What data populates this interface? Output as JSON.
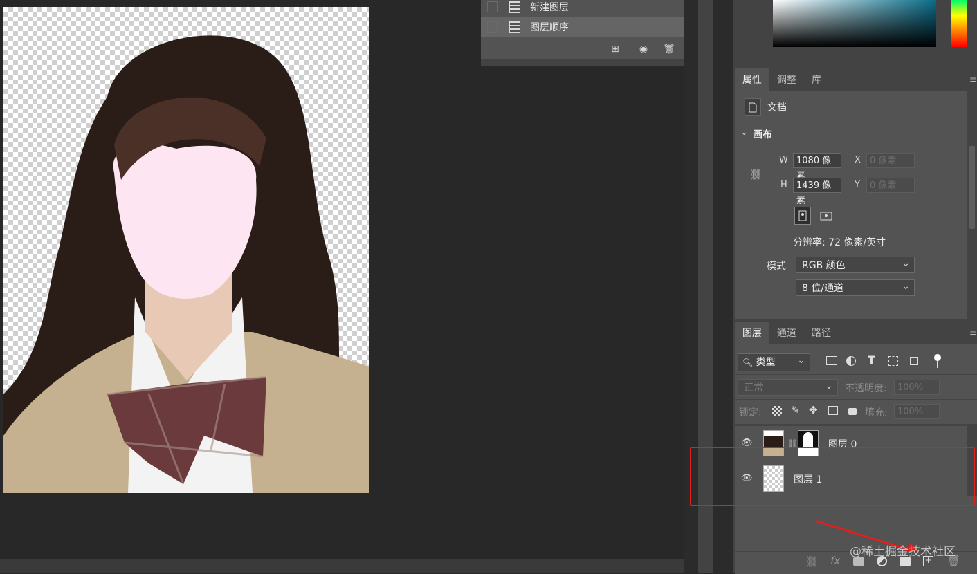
{
  "history": {
    "items": [
      {
        "label": "新建图层"
      },
      {
        "label": "图层顺序"
      }
    ]
  },
  "properties": {
    "tabs": [
      {
        "label": "属性"
      },
      {
        "label": "调整"
      },
      {
        "label": "库"
      }
    ],
    "doc_label": "文档",
    "section": "画布",
    "w_label": "W",
    "h_label": "H",
    "x_label": "X",
    "y_label": "Y",
    "width": "1080 像素",
    "height": "1439 像素",
    "x_placeholder": "0 像素",
    "y_placeholder": "0 像素",
    "resolution": "分辨率: 72 像素/英寸",
    "mode_label": "模式",
    "mode": "RGB 颜色",
    "bit_depth": "8 位/通道"
  },
  "layers_panel": {
    "tabs": [
      {
        "label": "图层"
      },
      {
        "label": "通道"
      },
      {
        "label": "路径"
      }
    ],
    "filter_kind": "类型",
    "blend_mode": "正常",
    "opacity_label": "不透明度:",
    "opacity": "100%",
    "lock_label": "锁定:",
    "fill_label": "填充:",
    "fill": "100%",
    "layers": [
      {
        "name": "图层 0",
        "visible": true,
        "has_mask": true
      },
      {
        "name": "图层 1",
        "visible": true,
        "has_mask": false
      }
    ],
    "footer_fx": "fx"
  },
  "watermark": "@稀土掘金技术社区",
  "colors": {
    "highlight": "#e01f1f",
    "panel_bg": "#535353",
    "workspace": "#282828"
  }
}
